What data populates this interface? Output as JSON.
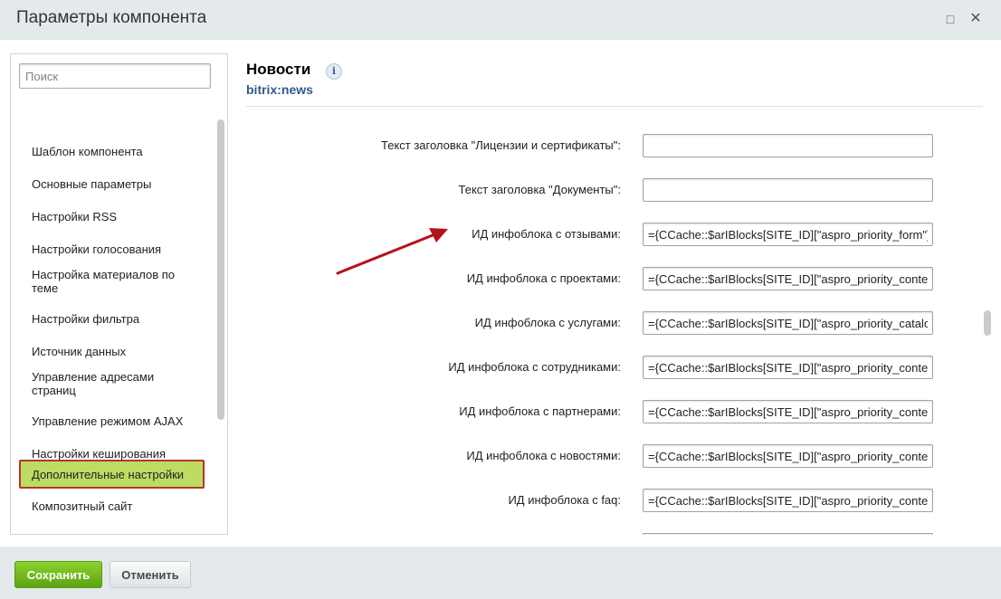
{
  "window": {
    "title": "Параметры компонента",
    "maximize_icon": "maximize-icon",
    "close_icon": "close-icon"
  },
  "sidebar": {
    "search_placeholder": "Поиск",
    "items": [
      {
        "label": "Шаблон компонента"
      },
      {
        "label": "Основные параметры"
      },
      {
        "label": "Настройки RSS"
      },
      {
        "label": "Настройки голосования"
      },
      {
        "label": "Настройка материалов по теме"
      },
      {
        "label": "Настройки фильтра"
      },
      {
        "label": "Источник данных"
      },
      {
        "label": "Управление адресами страниц"
      },
      {
        "label": "Управление режимом AJAX"
      },
      {
        "label": "Настройки кеширования"
      },
      {
        "label": "Дополнительные настройки",
        "active": true
      },
      {
        "label": "Композитный сайт"
      }
    ]
  },
  "component": {
    "title": "Новости",
    "code": "bitrix:news",
    "info_icon": "info-icon"
  },
  "params": [
    {
      "label": "Текст заголовка \"Лицензии и сертификаты\":",
      "value": ""
    },
    {
      "label": "Текст заголовка \"Документы\":",
      "value": ""
    },
    {
      "label": "ИД инфоблока с отзывами:",
      "value": "={CCache::$arIBlocks[SITE_ID][\"aspro_priority_form\"]"
    },
    {
      "label": "ИД инфоблока с проектами:",
      "value": "={CCache::$arIBlocks[SITE_ID][\"aspro_priority_content\"]"
    },
    {
      "label": "ИД инфоблока с услугами:",
      "value": "={CCache::$arIBlocks[SITE_ID][\"aspro_priority_catalog\"]"
    },
    {
      "label": "ИД инфоблока с сотрудниками:",
      "value": "={CCache::$arIBlocks[SITE_ID][\"aspro_priority_content\"]"
    },
    {
      "label": "ИД инфоблока с партнерами:",
      "value": "={CCache::$arIBlocks[SITE_ID][\"aspro_priority_content\"]"
    },
    {
      "label": "ИД инфоблока с новостями:",
      "value": "={CCache::$arIBlocks[SITE_ID][\"aspro_priority_content\"]"
    },
    {
      "label": "ИД инфоблока с faq:",
      "value": "={CCache::$arIBlocks[SITE_ID][\"aspro_priority_content\"]"
    },
    {
      "label": "",
      "value": ""
    }
  ],
  "colors": {
    "accent_green": "#6fba1d",
    "active_item_bg": "#bcdc64",
    "active_item_border": "#b9322a",
    "annotation_arrow": "#b5121b",
    "link_blue": "#2f5a8c"
  },
  "footer": {
    "save_label": "Сохранить",
    "cancel_label": "Отменить"
  }
}
